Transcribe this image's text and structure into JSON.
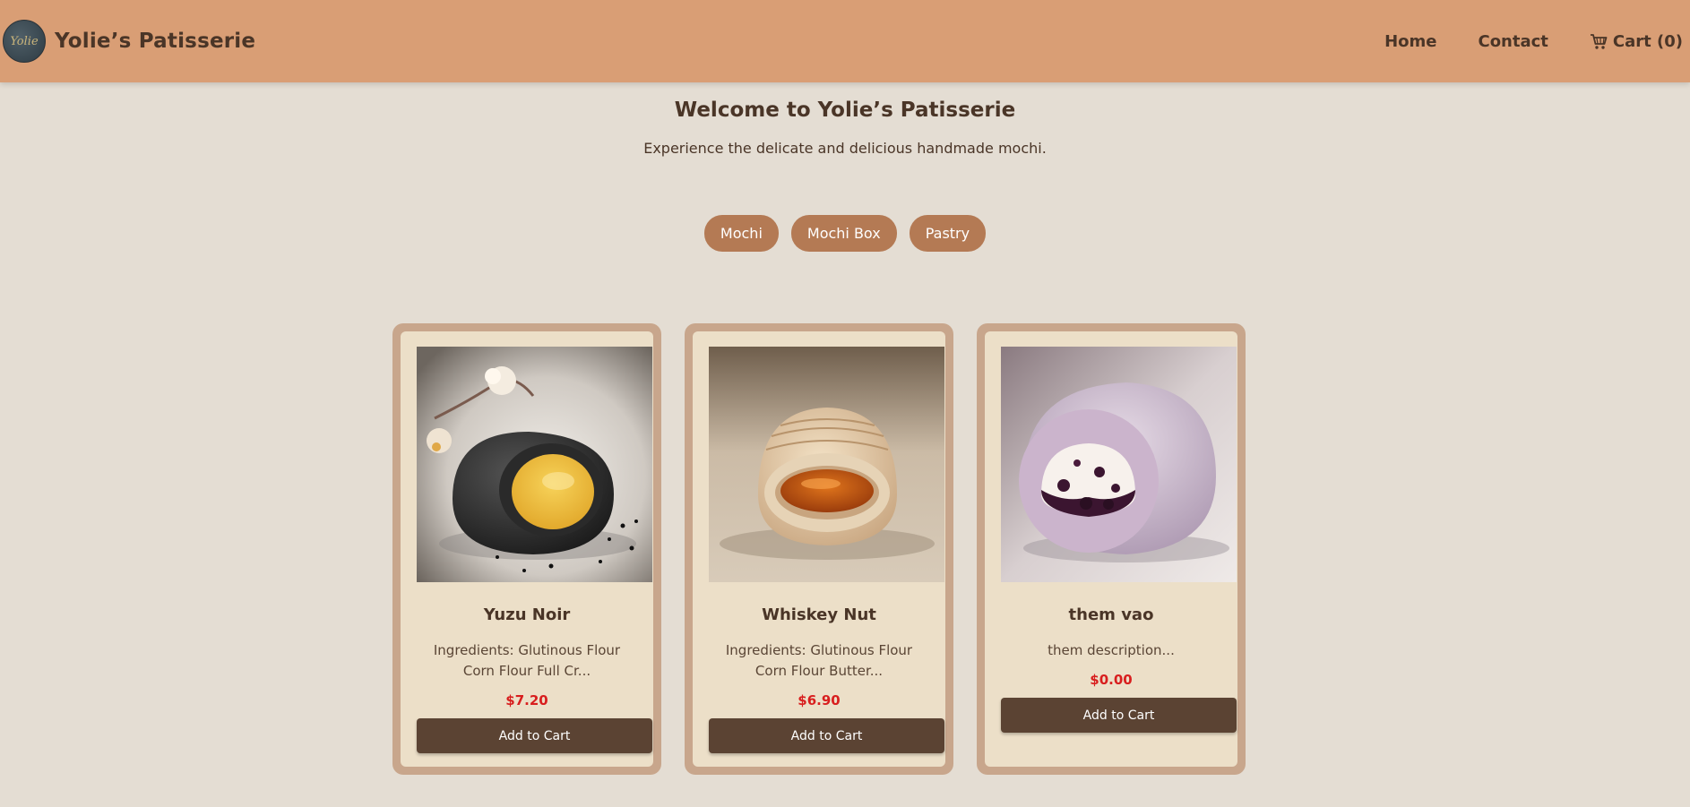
{
  "brand": {
    "name": "Yolie’s Patisserie",
    "logo_text": "Yolie",
    "logo_icon": "logo-icon"
  },
  "nav": {
    "home": "Home",
    "contact": "Contact",
    "cart": "Cart (0)",
    "cart_icon": "shopping-cart-icon"
  },
  "hero": {
    "title": "Welcome to Yolie’s Patisserie",
    "subtitle": "Experience the delicate and delicious handmade mochi."
  },
  "filters": [
    "Mochi",
    "Mochi Box",
    "Pastry"
  ],
  "products": [
    {
      "name": "Yuzu Noir",
      "description": "Ingredients: Glutinous Flour Corn Flour Full Cr...",
      "price": "$7.20",
      "button": "Add to Cart",
      "image": "black sesame mochi with yuzu filling"
    },
    {
      "name": "Whiskey Nut",
      "description": "Ingredients: Glutinous Flour Corn Flour Butter...",
      "price": "$6.90",
      "button": "Add to Cart",
      "image": "cream mochi with caramel filling"
    },
    {
      "name": "them vao",
      "description": "them description...",
      "price": "$0.00",
      "button": "Add to Cart",
      "image": "purple mochi with cream and berry filling"
    }
  ],
  "colors": {
    "header": "#d99e75",
    "background": "#e4ddd3",
    "text": "#4a3527",
    "filter_button": "#b47a54",
    "card_border": "#c8a68c",
    "card_bg": "#ecdfc8",
    "add_button": "#5b4333",
    "price": "#d81e1e"
  }
}
